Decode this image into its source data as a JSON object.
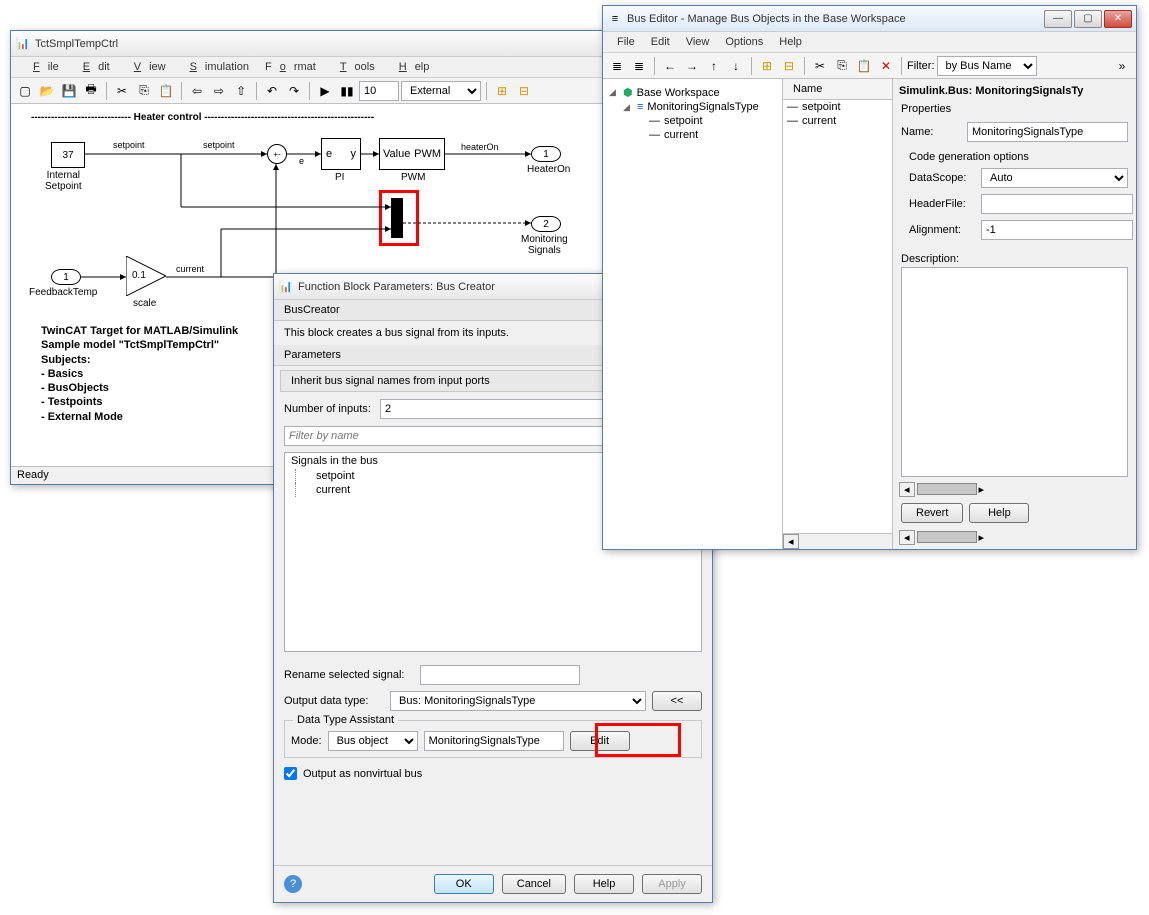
{
  "simulink": {
    "title": "TctSmplTempCtrl",
    "menu": [
      "File",
      "Edit",
      "View",
      "Simulation",
      "Format",
      "Tools",
      "Help"
    ],
    "step_value": "10",
    "mode_select": "External",
    "header": "------------------------------ Heater control ---------------------------------------------------",
    "note_lines": [
      "TwinCAT Target for MATLAB/Simulink",
      "Sample model \"TctSmplTempCtrl\"",
      "Subjects:",
      "- Basics",
      "- BusObjects",
      "- Testpoints",
      "- External Mode"
    ],
    "status": "Ready",
    "blocks": {
      "setpoint_val": "37",
      "setpoint_name": "Internal\nSetpoint",
      "feedback": "1",
      "feedback_name": "FeedbackTemp",
      "gain": "0.1",
      "gain_name": "scale",
      "pi_e": "e",
      "pi_y": "y",
      "pi_name": "PI",
      "pwm_v": "Value",
      "pwm_p": "PWM",
      "pwm_name": "PWM",
      "heater_out": "1",
      "heater_name": "HeaterOn",
      "heater_sig": "heaterOn",
      "mon_out": "2",
      "mon_name": "Monitoring\nSignals",
      "sig_setpoint": "setpoint",
      "sig_current": "current"
    }
  },
  "params": {
    "title": "Function Block Parameters: Bus Creator",
    "heading": "BusCreator",
    "desc": "This block creates a bus signal from its inputs.",
    "param_header": "Parameters",
    "inherit": "Inherit bus signal names from input ports",
    "num_inputs_label": "Number of inputs:",
    "num_inputs": "2",
    "filter_placeholder": "Filter by name",
    "signals_header": "Signals in the bus",
    "sig1": "setpoint",
    "sig2": "current",
    "rename_label": "Rename selected signal:",
    "odt_label": "Output data type:",
    "odt_value": "Bus: MonitoringSignalsType",
    "collapse": "<<",
    "dta_label": "Data Type Assistant",
    "mode_label": "Mode:",
    "mode_value": "Bus object",
    "mode_text": "MonitoringSignalsType",
    "edit": "Edit",
    "nonvirtual": "Output as nonvirtual bus",
    "ok": "OK",
    "cancel": "Cancel",
    "help": "Help",
    "apply": "Apply"
  },
  "bus": {
    "title": "Bus Editor - Manage Bus Objects in the Base Workspace",
    "menu": [
      "File",
      "Edit",
      "View",
      "Options",
      "Help"
    ],
    "filter_label": "Filter:",
    "filter_value": "by Bus Name",
    "tree_root": "Base Workspace",
    "tree_bus": "MonitoringSignalsType",
    "tree_sig1": "setpoint",
    "tree_sig2": "current",
    "name_col": "Name",
    "prop_title": "Simulink.Bus: MonitoringSignalsTy",
    "prop_header": "Properties",
    "name_label": "Name:",
    "name_value": "MonitoringSignalsType",
    "codegen": "Code generation options",
    "ds_label": "DataScope:",
    "ds_value": "Auto",
    "hf_label": "HeaderFile:",
    "hf_value": "",
    "al_label": "Alignment:",
    "al_value": "-1",
    "desc_label": "Description:",
    "revert": "Revert",
    "help": "Help"
  }
}
